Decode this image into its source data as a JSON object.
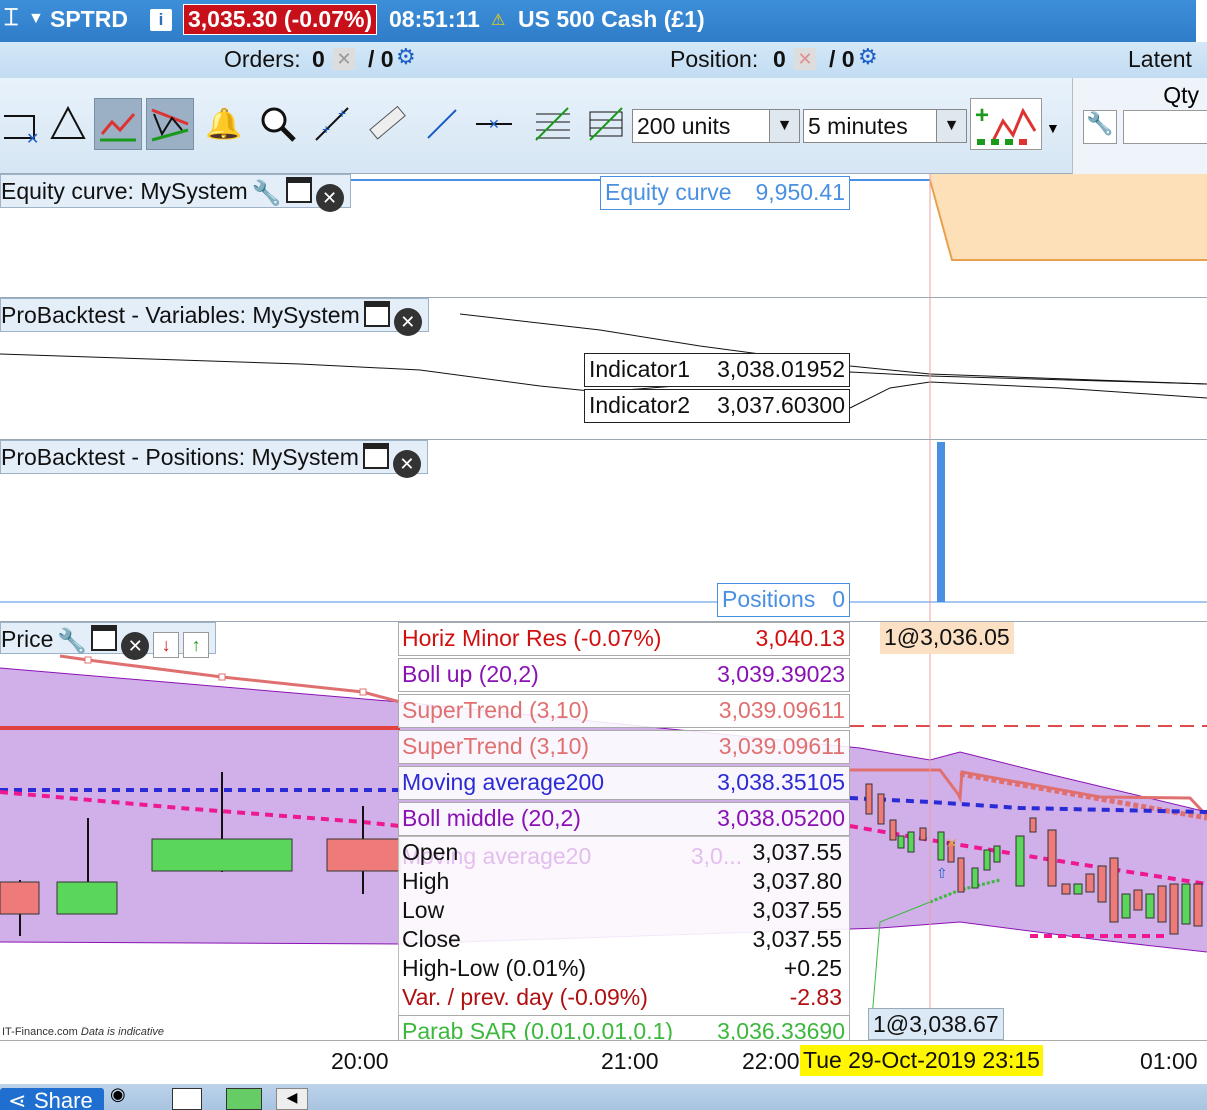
{
  "title_bar": {
    "symbol": "SPTRD",
    "info_icon": "i",
    "price_change": "3,035.30 (-0.07%)",
    "time": "08:51:11",
    "instrument": "US 500 Cash (£1)"
  },
  "orders_bar": {
    "orders_label": "Orders:",
    "orders_count": "0",
    "orders_sep": "/ 0",
    "position_label": "Position:",
    "position_count": "0",
    "position_sep": "/ 0",
    "latent_label": "Latent"
  },
  "toolbar": {
    "units_select": "200 units",
    "timeframe_select": "5 minutes",
    "qty_label": "Qty"
  },
  "equity_panel": {
    "title": "Equity curve: MySystem",
    "value_label": "Equity curve",
    "value": "9,950.41"
  },
  "variables_panel": {
    "title": "ProBacktest - Variables: MySystem",
    "indicator1_label": "Indicator1",
    "indicator1_value": "3,038.01952",
    "indicator2_label": "Indicator2",
    "indicator2_value": "3,037.60300"
  },
  "positions_panel": {
    "title": "ProBacktest - Positions: MySystem",
    "value_label": "Positions",
    "value": "0"
  },
  "price_panel": {
    "title": "Price",
    "trade_label_top": "1@3,036.05",
    "trade_label_bottom": "1@3,038.67",
    "watermark": "IT-Finance.com",
    "watermark_note": "Data is indicative",
    "legend": [
      {
        "label": "Horiz Minor Res (-0.07%)",
        "value": "3,040.13",
        "color": "#d01010"
      },
      {
        "label": "Boll up (20,2)",
        "value": "3,039.39023",
        "color": "#8a12b4"
      },
      {
        "label": "SuperTrend (3,10)",
        "value": "3,039.09611",
        "color": "#e07070"
      },
      {
        "label": "SuperTrend (3,10)",
        "value": "3,039.09611",
        "color": "#e07070"
      },
      {
        "label": "Moving average200",
        "value": "3,038.35105",
        "color": "#2b2bd6"
      },
      {
        "label": "Boll middle (20,2)",
        "value": "3,038.05200",
        "color": "#8a12b4"
      }
    ],
    "hidden_legend": {
      "label": "Moving average20",
      "value": "3,0..."
    },
    "ohlc": [
      {
        "label": "Open",
        "value": "3,037.55",
        "color": "#111111"
      },
      {
        "label": "High",
        "value": "3,037.80",
        "color": "#111111"
      },
      {
        "label": "Low",
        "value": "3,037.55",
        "color": "#111111"
      },
      {
        "label": "Close",
        "value": "3,037.55",
        "color": "#111111"
      },
      {
        "label": "High-Low (0.01%)",
        "value": "+0.25",
        "color": "#111111"
      },
      {
        "label": "Var. / prev. day (-0.09%)",
        "value": "-2.83",
        "color": "#b01010"
      },
      {
        "label": "Parab SAR (0.01,0.01,0.1)",
        "value": "3,036.33690",
        "color": "#3cb83c"
      }
    ]
  },
  "time_axis": {
    "ticks": [
      "20:00",
      "21:00",
      "22:00",
      "01:00"
    ],
    "crosshair": "Tue 29-Oct-2019 23:15"
  },
  "bottom_bar": {
    "share_label": "Share"
  }
}
